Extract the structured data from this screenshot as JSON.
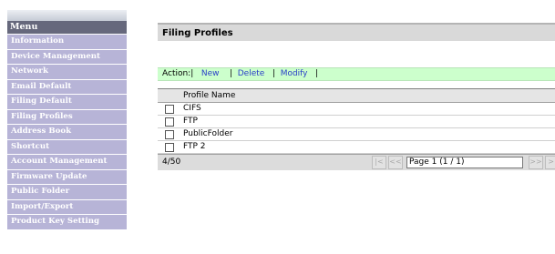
{
  "sidebar": {
    "header": "Menu",
    "items": [
      {
        "label": "Information"
      },
      {
        "label": "Device Management"
      },
      {
        "label": "Network"
      },
      {
        "label": "Email Default"
      },
      {
        "label": "Filing Default"
      },
      {
        "label": "Filing Profiles"
      },
      {
        "label": "Address Book"
      },
      {
        "label": "Shortcut"
      },
      {
        "label": "Account Management"
      },
      {
        "label": "Firmware Update"
      },
      {
        "label": "Public Folder"
      },
      {
        "label": "Import/Export"
      },
      {
        "label": "Product Key Setting"
      }
    ]
  },
  "main": {
    "title": "Filing Profiles",
    "actions": {
      "label": "Action:|",
      "new": "New",
      "delete": "Delete",
      "modify": "Modify"
    },
    "table": {
      "column_header": "Profile Name",
      "rows": [
        {
          "name": "CIFS"
        },
        {
          "name": "FTP"
        },
        {
          "name": "PublicFolder"
        },
        {
          "name": "FTP 2"
        }
      ]
    },
    "footer": {
      "count": "4/50",
      "first": "|<",
      "prev": "<<",
      "page_value": "Page 1 (1 / 1)",
      "next": ">>",
      "last": ">|"
    }
  },
  "colors": {
    "menu_header": "#66687c",
    "menu_item": "#b7b4d7",
    "action_bar": "#ccffcc",
    "link": "#2a41c8"
  }
}
